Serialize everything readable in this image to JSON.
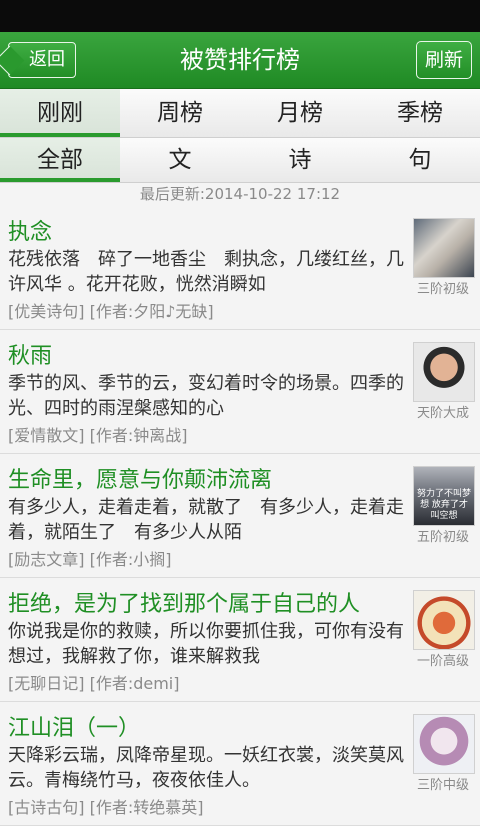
{
  "header": {
    "title": "被赞排行榜",
    "back_label": "返回",
    "refresh_label": "刷新",
    "accent": "#2a9b2e"
  },
  "tabs_primary": [
    {
      "label": "刚刚",
      "active": true
    },
    {
      "label": "周榜"
    },
    {
      "label": "月榜"
    },
    {
      "label": "季榜"
    }
  ],
  "tabs_secondary": [
    {
      "label": "全部",
      "active": true
    },
    {
      "label": "文"
    },
    {
      "label": "诗"
    },
    {
      "label": "句"
    }
  ],
  "last_update": "最后更新:2014-10-22 17:12",
  "items": [
    {
      "title": "执念",
      "text": "花残依落　碎了一地香尘　剩执念，几缕红丝，几许风华 。花开花败，恍然消瞬如",
      "meta": "[优美诗句] [作者:夕阳♪无缺]",
      "level": "三阶初级",
      "thumb": "t1",
      "thumb_text": ""
    },
    {
      "title": "秋雨",
      "text": "季节的风、季节的云，变幻着时令的场景。四季的光、四时的雨涅槃感知的心",
      "meta": "[爱情散文] [作者:钟离战]",
      "level": "天阶大成",
      "thumb": "t2",
      "thumb_text": ""
    },
    {
      "title": "生命里，愿意与你颠沛流离",
      "text": "有多少人，走着走着，就散了　有多少人，走着走着，就陌生了　有多少人从陌",
      "meta": "[励志文章] [作者:小搁]",
      "level": "五阶初级",
      "thumb": "t3",
      "thumb_text": "努力了不叫梦想 放弃了才叫空想"
    },
    {
      "title": "拒绝，是为了找到那个属于自己的人",
      "text": "你说我是你的救赎，所以你要抓住我，可你有没有想过，我解救了你，谁来解救我",
      "meta": "[无聊日记] [作者:demi]",
      "level": "一阶高级",
      "thumb": "t4",
      "thumb_text": ""
    },
    {
      "title": "江山泪（一）",
      "text": "天降彩云瑞，凤降帝星现。一妖红衣裳，淡笑莫风云。青梅绕竹马，夜夜依佳人。",
      "meta": "[古诗古句] [作者:转绝慕英]",
      "level": "三阶中级",
      "thumb": "t5",
      "thumb_text": ""
    }
  ]
}
